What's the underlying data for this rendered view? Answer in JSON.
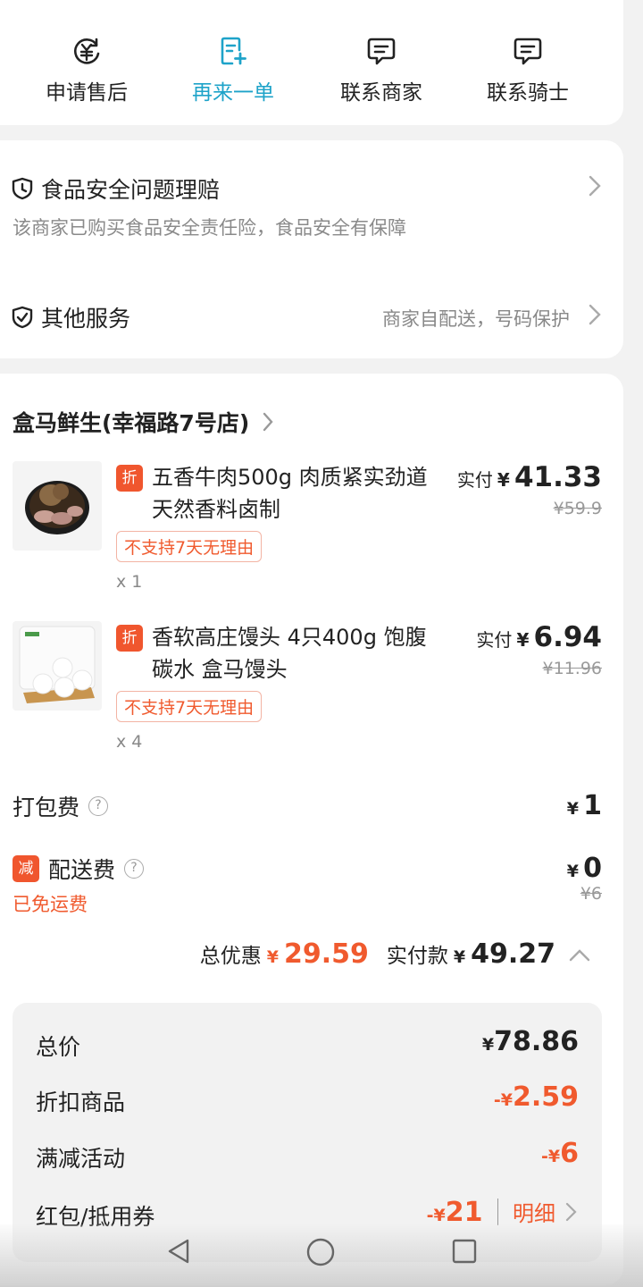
{
  "actions": [
    {
      "label": "申请售后",
      "icon": "yen-refund-icon"
    },
    {
      "label": "再来一单",
      "icon": "reorder-icon"
    },
    {
      "label": "联系商家",
      "icon": "chat-icon"
    },
    {
      "label": "联系骑士",
      "icon": "chat-icon"
    }
  ],
  "services": {
    "food_safety_title": "食品安全问题理赔",
    "food_safety_sub": "该商家已购买食品安全责任险，食品安全有保障",
    "other_title": "其他服务",
    "other_value": "商家自配送，号码保护"
  },
  "order": {
    "store_name": "盒马鲜生(幸福路7号店)",
    "items": [
      {
        "badge": "折",
        "name": "五香牛肉500g 肉质紧实劲道 天然香料卤制",
        "tag": "不支持7天无理由",
        "qty": "x 1",
        "paid_label": "实付",
        "currency": "¥",
        "paid": "41.33",
        "original": "¥59.9"
      },
      {
        "badge": "折",
        "name": "香软高庄馒头 4只400g 饱腹碳水 盒马馒头",
        "tag": "不支持7天无理由",
        "qty": "x 4",
        "paid_label": "实付",
        "currency": "¥",
        "paid": "6.94",
        "original": "¥11.96"
      }
    ],
    "packing_fee": {
      "label": "打包费",
      "currency": "¥",
      "value": "1"
    },
    "delivery_fee": {
      "badge": "减",
      "label": "配送费",
      "currency": "¥",
      "value": "0",
      "original": "¥6",
      "note": "已免运费"
    },
    "summary": {
      "discount_label": "总优惠",
      "currency": "¥",
      "discount_value": "29.59",
      "paid_label": "实付款",
      "paid_value": "49.27"
    },
    "breakdown": [
      {
        "label": "总价",
        "sign": "",
        "currency": "¥",
        "value": "78.86",
        "highlight": false
      },
      {
        "label": "折扣商品",
        "sign": "-",
        "currency": "¥",
        "value": "2.59",
        "highlight": true
      },
      {
        "label": "满减活动",
        "sign": "-",
        "currency": "¥",
        "value": "6",
        "highlight": true
      },
      {
        "label": "红包/抵用券",
        "sign": "-",
        "currency": "¥",
        "value": "21",
        "highlight": true,
        "link": "明细"
      }
    ]
  },
  "colors": {
    "accent": "#1ea3c9",
    "discount": "#f05a2e"
  }
}
